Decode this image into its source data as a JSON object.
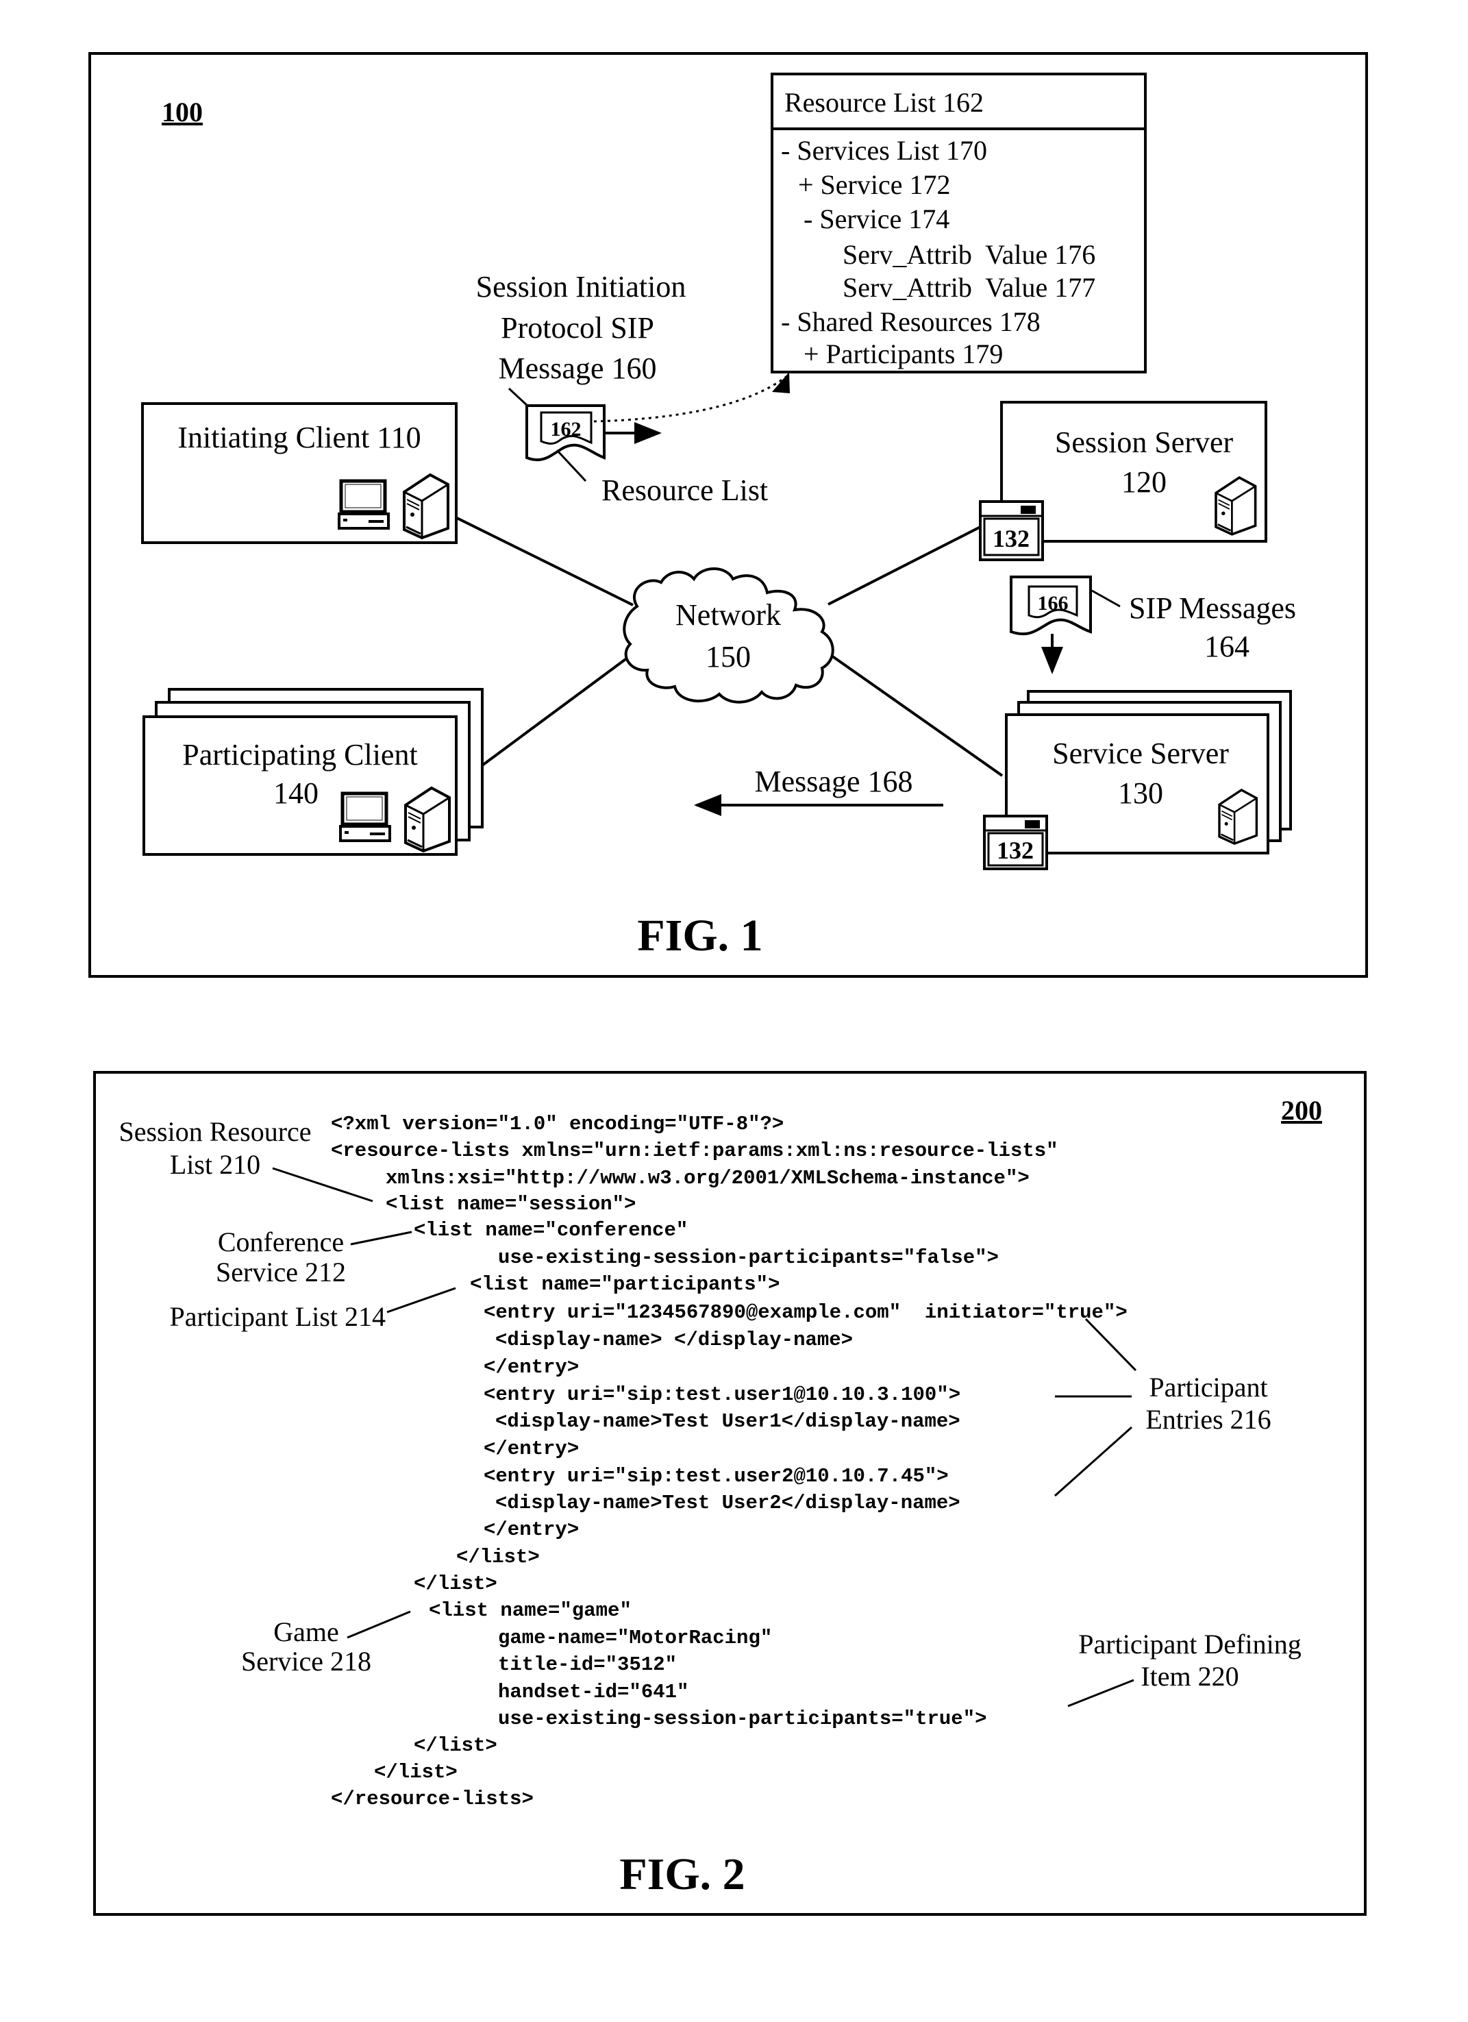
{
  "fig1": {
    "ref": "100",
    "caption": "FIG. 1",
    "resource_list_box": {
      "title": "Resource List 162",
      "rows": [
        "- Services List 170",
        "+ Service 172",
        "- Service 174",
        "Serv_Attrib  Value 176",
        "Serv_Attrib  Value 177",
        "- Shared Resources 178",
        "+ Participants 179"
      ]
    },
    "sip_message": {
      "label_lines": [
        "Session Initiation",
        "Protocol SIP",
        "Message 160"
      ],
      "doc_ref": "162",
      "pointer_label": "Resource List"
    },
    "initiating_client": {
      "label": "Initiating Client 110"
    },
    "session_server": {
      "label_lines": [
        "Session Server",
        "120"
      ],
      "widget_ref": "132"
    },
    "network": {
      "label_lines": [
        "Network",
        "150"
      ]
    },
    "sip_messages": {
      "doc_ref": "166",
      "label_lines": [
        "SIP Messages",
        "164"
      ]
    },
    "participating_client": {
      "label_lines": [
        "Participating Client",
        "140"
      ]
    },
    "service_server": {
      "label_lines": [
        "Service Server",
        "130"
      ],
      "widget_ref": "132"
    },
    "message_168": {
      "label": "Message 168"
    }
  },
  "fig2": {
    "ref": "200",
    "caption": "FIG. 2",
    "code_lines": [
      "<?xml version=\"1.0\" encoding=\"UTF-8\"?>",
      "<resource-lists xmlns=\"urn:ietf:params:xml:ns:resource-lists\"",
      "xmlns:xsi=\"http://www.w3.org/2001/XMLSchema-instance\">",
      "<list name=\"session\">",
      "<list name=\"conference\"",
      "use-existing-session-participants=\"false\">",
      "<list name=\"participants\">",
      "<entry uri=\"1234567890@example.com\"  initiator=\"true\">",
      "<display-name> </display-name>",
      "</entry>",
      "<entry uri=\"sip:test.user1@10.10.3.100\">",
      "<display-name>Test User1</display-name>",
      "</entry>",
      "<entry uri=\"sip:test.user2@10.10.7.45\">",
      "<display-name>Test User2</display-name>",
      "</entry>",
      "</list>",
      "</list>",
      "<list name=\"game\"",
      "game-name=\"MotorRacing\"",
      "title-id=\"3512\"",
      "handset-id=\"641\"",
      "use-existing-session-participants=\"true\">",
      "</list>",
      "</list>",
      "</resource-lists>"
    ],
    "annotations": {
      "session_resource_list": [
        "Session Resource",
        "List 210"
      ],
      "conference_service": [
        "Conference",
        "Service 212"
      ],
      "participant_list": [
        "Participant List 214"
      ],
      "participant_entries": [
        "Participant",
        "Entries 216"
      ],
      "game_service": [
        "Game",
        "Service 218"
      ],
      "participant_defining_item": [
        "Participant Defining",
        "Item 220"
      ]
    }
  }
}
